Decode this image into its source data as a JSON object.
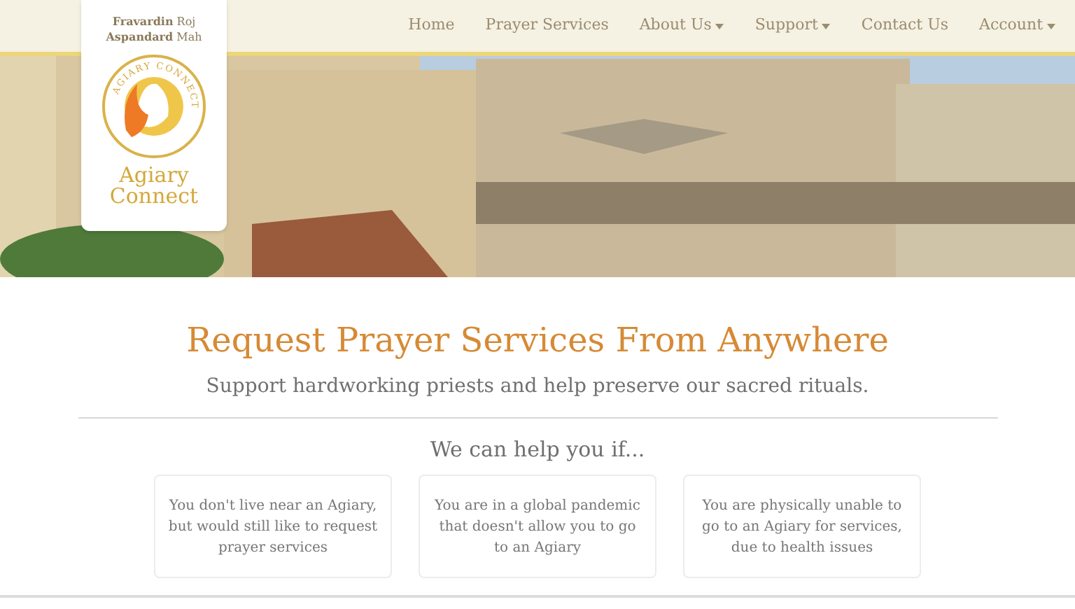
{
  "header": {
    "date_lines": [
      {
        "bold": "Fravardin",
        "rest": "Roj"
      },
      {
        "bold": "Aspandard",
        "rest": "Mah"
      }
    ],
    "logo": {
      "ring_text": "AGIARY CONNECT",
      "name_lines": [
        "Agiary",
        "Connect"
      ]
    },
    "nav": [
      {
        "label": "Home",
        "dropdown": false
      },
      {
        "label": "Prayer Services",
        "dropdown": false
      },
      {
        "label": "About Us",
        "dropdown": true
      },
      {
        "label": "Support",
        "dropdown": true
      },
      {
        "label": "Contact Us",
        "dropdown": false
      },
      {
        "label": "Account",
        "dropdown": true
      }
    ]
  },
  "hero": {
    "title": "Request Prayer Services From Anywhere",
    "subtitle": "Support hardworking priests and help preserve our sacred rituals."
  },
  "help": {
    "heading": "We can help you if...",
    "cards": [
      "You don't live near an Agiary, but would still like to request prayer services",
      "You are in a global pandemic that doesn't allow you to go to an Agiary",
      "You are physically unable to go to an Agiary for services, due to health issues"
    ]
  }
}
